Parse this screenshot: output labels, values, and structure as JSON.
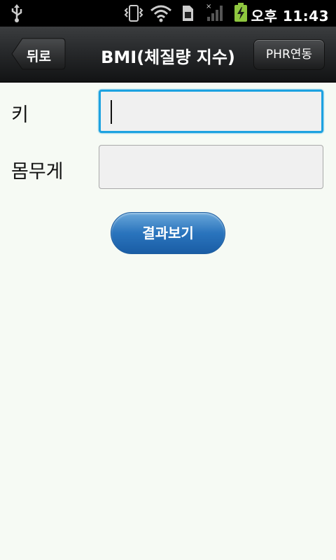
{
  "status_bar": {
    "time": "오후 11:43",
    "icons": [
      "usb-icon",
      "vibrate-icon",
      "wifi-icon",
      "sim-icon",
      "signal-icon",
      "battery-charging-icon"
    ]
  },
  "header": {
    "back_label": "뒤로",
    "title": "BMI(체질량 지수)",
    "phr_label": "PHR연동"
  },
  "form": {
    "height_label": "키",
    "height_value": "",
    "height_placeholder": "",
    "weight_label": "몸무게",
    "weight_value": "",
    "weight_placeholder": ""
  },
  "actions": {
    "result_label": "결과보기"
  },
  "colors": {
    "focus_border": "#1da2e0",
    "button_blue": "#2a74bd",
    "background": "#f6faf4"
  }
}
